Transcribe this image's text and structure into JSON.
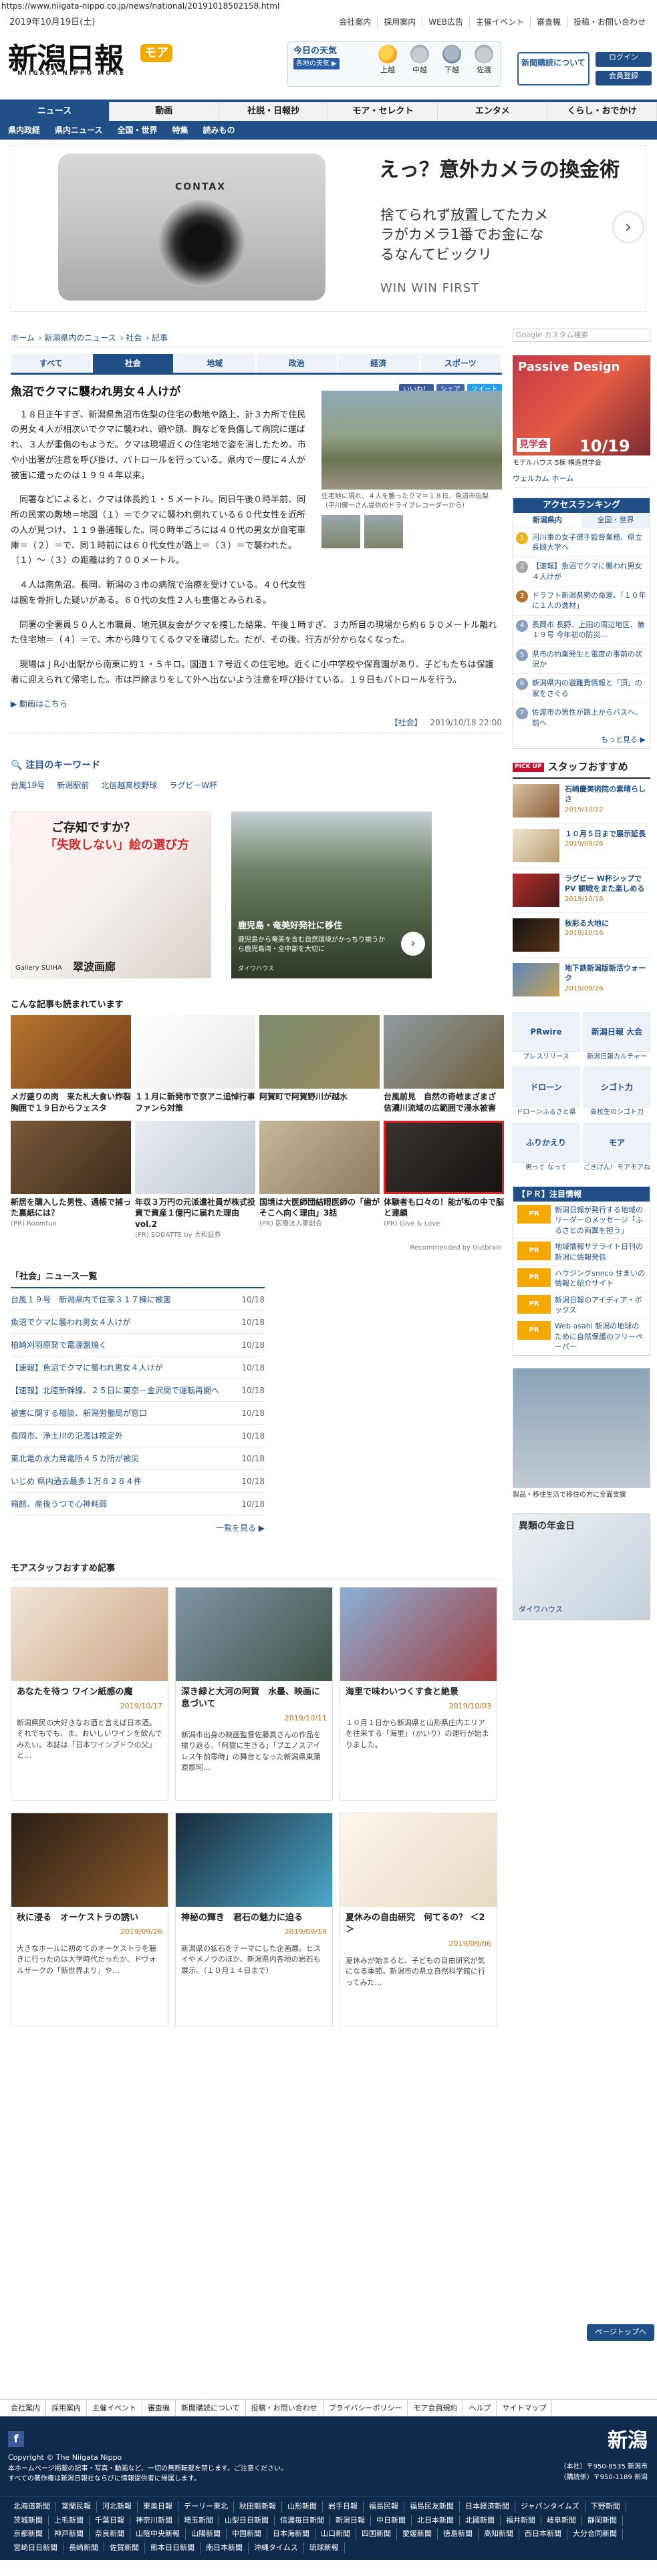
{
  "url": "https://www.niigata-nippo.co.jp/news/national/20191018502158.html",
  "header": {
    "date": "2019年10月19日(土)",
    "logo_title": "新潟日報",
    "logo_moa": "モア",
    "logo_sub": "NIIGATA NIPPO MORE",
    "toplinks": [
      "会社案内",
      "採用案内",
      "WEB広告",
      "主催イベント",
      "審査機",
      "投稿・お問い合わせ"
    ],
    "weather_title": "今日の天気",
    "weather_sub": "各地の天気 ▶",
    "weather": [
      {
        "name": "上越",
        "type": "sun"
      },
      {
        "name": "中越",
        "type": "cloud"
      },
      {
        "name": "下越",
        "type": "rain"
      },
      {
        "name": "佐渡",
        "type": "cloud"
      }
    ],
    "subscribe_label": "新聞購読について",
    "login_label": "ログイン",
    "join_label": "会員登録"
  },
  "nav": {
    "items": [
      "ニュース",
      "動画",
      "社説・日報抄",
      "モア・セレクト",
      "エンタメ",
      "くらし・おでかけ"
    ],
    "active": 0
  },
  "subnav": {
    "items": [
      "県内政経",
      "県内ニュース",
      "全国・世界",
      "特集",
      "読みもの"
    ],
    "moa_tag": "モア 天気"
  },
  "banner": {
    "headline": "えっ？意外カメラの換金術",
    "body": "捨てられず放置してたカメラがカメラ1番でお金になるなんてビックリ",
    "brand": "WIN WIN FIRST"
  },
  "breadcrumb": [
    "ホーム",
    "新潟県内のニュース",
    "社会",
    "記事"
  ],
  "tabs": {
    "items": [
      "すべて",
      "社会",
      "地域",
      "政治",
      "経済",
      "スポーツ"
    ],
    "active": 1
  },
  "article": {
    "title": "魚沼でクマに襲われ男女４人けが",
    "social": [
      "いいね！",
      "シェア",
      "ツイート"
    ],
    "photo_caption": "住宅地に現れ、４人を襲ったクマ＝１８日、魚沼市佐梨（平川健一さん提供のドライブレコーダーから）",
    "paragraphs": [
      "１８日正午すぎ、新潟県魚沼市佐梨の住宅の敷地や路上、計３カ所で住民の男女４人が相次いでクマに襲われ、頭や顔、胸などを負傷して病院に運ばれ、３人が重傷のもようだ。クマは現場近くの住宅地で姿を消したため、市や小出署が注意を呼び掛け、パトロールを行っている。県内で一度に４人が被害に遭ったのは１９９４年以来。",
      "同署などによると、クマは体長約１・５メートル。同日午後０時半前、同所の民家の敷地＝地図（１）＝でクマに襲われ倒れている６０代女性を近所の人が見つけ、１１９番通報した。同０時半ごろには４０代の男女が自宅車庫＝（２）＝で、同１時前には６０代女性が路上＝（３）＝で襲われた。（１）～（３）の距離は約７００メートル。",
      "４人は南魚沼、長岡、新潟の３市の病院で治療を受けている。４０代女性は腕を骨折した疑いがある。６０代の女性２人も重傷とみられる。"
    ],
    "paragraphs_full": [
      "同署の全署員５０人と市職員、地元猟友会がクマを捜した結果、午後１時すぎ、３カ所目の現場から約６５０メートル離れた住宅地＝（４）＝で、木から降りてくるクマを確認した。だが、その後、行方が分からなくなった。",
      "現場は J R小出駅から南東に約１・５キロ。国道１７号近くの住宅地。近くに小中学校や保育園があり、子どもたちは保護者に迎えられて帰宅した。市は戸締まりをして外へ出ないよう注意を呼び掛けている。１９日もパトロールを行う。"
    ],
    "more_link": "▶ 動画はこちら",
    "category": "【社会】",
    "datetime": "2019/10/18 22:00"
  },
  "keywords": {
    "title": "注目のキーワード",
    "items": [
      "台風19号",
      "新潟駅前",
      "北信越高校野球",
      "ラグビーW杯"
    ]
  },
  "ad_a": {
    "line1": "ご存知ですか？",
    "line2": "「失敗しない」絵の選び方",
    "brand": "翠波画廊",
    "sub": "Gallery SUIHA"
  },
  "ad_b": {
    "line1": "鹿児島・奄美好発社に移住",
    "line2": "鹿児島から奄美を含む自然環境がかっちり揃うから鹿児島湾・全中部を大切に",
    "line3": "ダイワハウス"
  },
  "recommend": {
    "title": "こんな記事も読まれています",
    "items": [
      {
        "t": "メガ盛りの肉　来た札大食い炸裂 胸囲で１９日からフェスタ",
        "src": "",
        "c1": "#b7762f",
        "c2": "#6e3d18"
      },
      {
        "t": "１１月に新発市で京アニ追悼行事 ファンら対策",
        "src": "",
        "c1": "#ffffff",
        "c2": "#e8e8e8"
      },
      {
        "t": "阿賀町で阿賀野川が越水",
        "src": "",
        "c1": "#7d8c6f",
        "c2": "#9b8a5c"
      },
      {
        "t": "台風前見　自然の奇岐まざまざ 信濃川流域の広範囲で浸水被害",
        "src": "",
        "c1": "#8f9aa0",
        "c2": "#6f5e3c"
      },
      {
        "t": "新居を購入した男性、通帳で捕った裏紙には？",
        "src": "(PR) Roomfun",
        "c1": "#7a5a3a",
        "c2": "#3c2a1a"
      },
      {
        "t": "年収３万円の元派遣社員が株式投資で資産１億円に届れた理由 vol.2",
        "src": "(PR) SODATTE by 大和証券",
        "c1": "#e9eef3",
        "c2": "#bfc6cf"
      },
      {
        "t": "国境は大医師団結眼医師の「歯がそこへ向く理由」3話",
        "src": "(PR) 医療法人東創会",
        "c1": "#c9b79a",
        "c2": "#8e7a5c"
      },
      {
        "t": "体験者も口々の！能が私の中で脳と連鎖",
        "src": "(PR) Give & Love",
        "c1": "#3a3330",
        "c2": "#151211"
      }
    ],
    "by": "Recommended by Outbrain"
  },
  "list": {
    "title": "「社会」ニュース一覧",
    "rows": [
      {
        "t": "台風１９号　新潟県内で住家３１７棟に被害",
        "d": "10/18"
      },
      {
        "t": "魚沼でクマに襲われ男女４人けが",
        "d": "10/18"
      },
      {
        "t": "柏崎刈羽原発で電源盤焼く",
        "d": "10/18"
      },
      {
        "t": "【速報】魚沼でクマに襲われ男女４人けが",
        "d": "10/18"
      },
      {
        "t": "【速報】北陸新幹線、２５日に東京－金沢間で運転再開へ",
        "d": "10/18"
      },
      {
        "t": "被害に関する相談、新潟労働局が窓口",
        "d": "10/18"
      },
      {
        "t": "長岡市、浄土川の氾濫は規定外",
        "d": "10/18"
      },
      {
        "t": "東北電の水力発電所４５カ所が被災",
        "d": "10/18"
      },
      {
        "t": "いじめ 県内過去最多１万８２８４件",
        "d": "10/18"
      },
      {
        "t": "箱館、産後うつで心神耗弱",
        "d": "10/18"
      }
    ],
    "more": "一覧を見る ▶"
  },
  "staff": {
    "title": "モアスタッフおすすめ記事",
    "items": [
      {
        "t": "あなたを待つ ワイン紙感の魔",
        "d": "2019/10/17",
        "e": "新潟県民の大好きなお酒と言えば日本酒。それでもでも、ま、おいしいワインを飲んでみたい。本誌は「日本ワインブドウの父」と…",
        "c1": "#f3e6d8",
        "c2": "#caa483"
      },
      {
        "t": "深き緑と大河の阿賀　水墨、映画に息づいて",
        "d": "2019/10/11",
        "e": "新潟市出身の映画監督佐藤真さんの作品を振り返る、「阿賀に生きる」「プエノスアイレス午前零時」の舞台となった新潟県東蒲原郡阿…",
        "c1": "#7f96a8",
        "c2": "#3e5446"
      },
      {
        "t": "海里で味わいつくす食と絶景",
        "d": "2019/10/03",
        "e": "１０月１日から新潟県と山形県庄内エリアを往来する「海里」（かいり）の運行が始まりました。",
        "c1": "#8ab0d8",
        "c2": "#a33c3c"
      },
      {
        "t": "秋に浸る　オーケストラの誘い",
        "d": "2019/09/26",
        "e": "大きなホールに初めてのオーケストラを聴きに行ったのは大学時代だったか、ドヴォルザークの「新世界より」や…",
        "c1": "#2a1d15",
        "c2": "#8a5a2a"
      },
      {
        "t": "神秘の輝き　君石の魅力に迫る",
        "d": "2019/09/19",
        "e": "新潟県の鉱石をテーマにした企画展。ヒスイやメノウのほか、新潟県内各地の岩石も展示。（１０月１４日まで）",
        "c1": "#1a2a3a",
        "c2": "#4aa8c8"
      },
      {
        "t": "夏休みの自由研究　何てるの？ ＜2＞",
        "d": "2019/09/06",
        "e": "夏休みが始まると、子どもの自由研究が気になる季節。新潟市の県立自然科学館に行ってみた…",
        "c1": "#fdf7ef",
        "c2": "#e8d9c2"
      }
    ]
  },
  "sidebar": {
    "search_placeholder": "Google カスタム検索",
    "ad_main": "Passive Design",
    "ad_sub": "10/19",
    "ad_tag": "見学会",
    "ad_cap": "モデルハウス 5棟 構造見学会",
    "web_items": [
      "ウェルカム",
      "ホーム"
    ],
    "rank": {
      "title": "アクセスランキング",
      "tabs": [
        "新潟県内",
        "全国・世界"
      ],
      "items": [
        "河川事の女子選手監督業務、県立長岡大学へ",
        "【速報】魚沼でクマに襲われ男女４人けが",
        "ドラフト新潟県勢の命運、「１０年に１人の逸材」",
        "長岡市 長野、上田の周辺地区、第１９号 今年初の防災...",
        "県市の約業発生と電度の事前の状況か",
        "新潟県内の避難費情報と「頂」の家をさぐる",
        "佐渡市の男性が路上からバスへ、前へ"
      ],
      "more": "もっと見る ▶"
    },
    "staff_side": {
      "pickup": "PICK UP",
      "title": "スタッフおすすめ",
      "items": [
        {
          "t": "石崎慶美術院の素晴らしさ",
          "d": "2019/10/22",
          "c1": "#d9c3a3",
          "c2": "#8a5c38"
        },
        {
          "t": "１０月５日まで展示延長",
          "d": "2019/09/26",
          "c1": "#efe6d3",
          "c2": "#b79a6d"
        },
        {
          "t": "ラグビー W杯シップでPV 観戦をまた楽しめる",
          "d": "2019/10/18",
          "c1": "#b72d2d",
          "c2": "#4a1a1a"
        },
        {
          "t": "秋彩る大地に",
          "d": "2019/10/16",
          "c1": "#151212",
          "c2": "#5a3418"
        },
        {
          "t": "地下鉄新潟版新活ウォーク",
          "d": "2019/09/26",
          "c1": "#5a85b8",
          "c2": "#c8a35a"
        }
      ]
    },
    "logos": [
      {
        "t": "プレスリリース",
        "lg": "PRwire"
      },
      {
        "t": "新潟日報カルチャー",
        "lg": "新潟日報 大会"
      },
      {
        "t": "ドローンふるさと県",
        "lg": "ドローン"
      },
      {
        "t": "高校生のシゴト力",
        "lg": "シゴト力"
      },
      {
        "t": "男って なって",
        "lg": "ふりかえり"
      },
      {
        "t": "ごきげん！モアモアね",
        "lg": "モア"
      }
    ],
    "pr": {
      "title": "【ＰＲ】注目情報",
      "items": [
        "新潟日報が発行する地域のリーダーのメッセージ「ふるさとの両翼を担う」",
        "地域情報サテライト日刊の新潟に情報発信",
        "ハウジングsnnco 住まいの情報と紹介サイト",
        "新潟日報のアイディア・ボックス",
        "Web asahi 新潟の地球のために自然保護のフリーペーパー"
      ]
    },
    "ad2_cap": "製品・移住生活で移住の方に全面支援",
    "ad3_t1": "異類の年金日",
    "ad3_t2": "ダイワハウス"
  },
  "footer": {
    "nav": [
      "会社案内",
      "採用案内",
      "主催イベント",
      "審査機",
      "新聞購読について",
      "投稿・お問い合わせ",
      "プライバシーポリシー",
      "モア会員規約",
      "ヘルプ",
      "サイトマップ"
    ],
    "copyright": "Copyright © The Niigata Nippo",
    "note1": "本ホームページ掲載の記事・写真・動画など、一切の無断転載を禁じます。ご注意ください。",
    "note2": "すべての著作権は新潟日報社ならびに情報提供者に帰属します。",
    "brand": "新潟",
    "addr": "（本社）〒950-8535 新潟市\n（購読係）〒950-1189 新潟",
    "links": [
      "北海道新聞",
      "室蘭民報",
      "河北新報",
      "東奥日報",
      "デーリー東北",
      "秋田魁新報",
      "山形新聞",
      "岩手日報",
      "福島民報",
      "福島民友新聞",
      "日本経済新聞",
      "ジャパンタイムズ",
      "下野新聞",
      "茨城新聞",
      "上毛新聞",
      "千葉日報",
      "神奈川新聞",
      "埼玉新聞",
      "山梨日日新聞",
      "信濃毎日新聞",
      "新潟日報",
      "中日新聞",
      "北日本新聞",
      "北國新聞",
      "福井新聞",
      "岐阜新聞",
      "静岡新聞",
      "京都新聞",
      "神戸新聞",
      "奈良新聞",
      "山陰中央新報",
      "山陽新聞",
      "中国新聞",
      "日本海新聞",
      "山口新聞",
      "四国新聞",
      "愛媛新聞",
      "徳島新聞",
      "高知新聞",
      "西日本新聞",
      "大分合同新聞",
      "宮崎日日新聞",
      "長崎新聞",
      "佐賀新聞",
      "熊本日日新聞",
      "南日本新聞",
      "沖縄タイムス",
      "琉球新報"
    ]
  },
  "page_top": "ページトップへ"
}
